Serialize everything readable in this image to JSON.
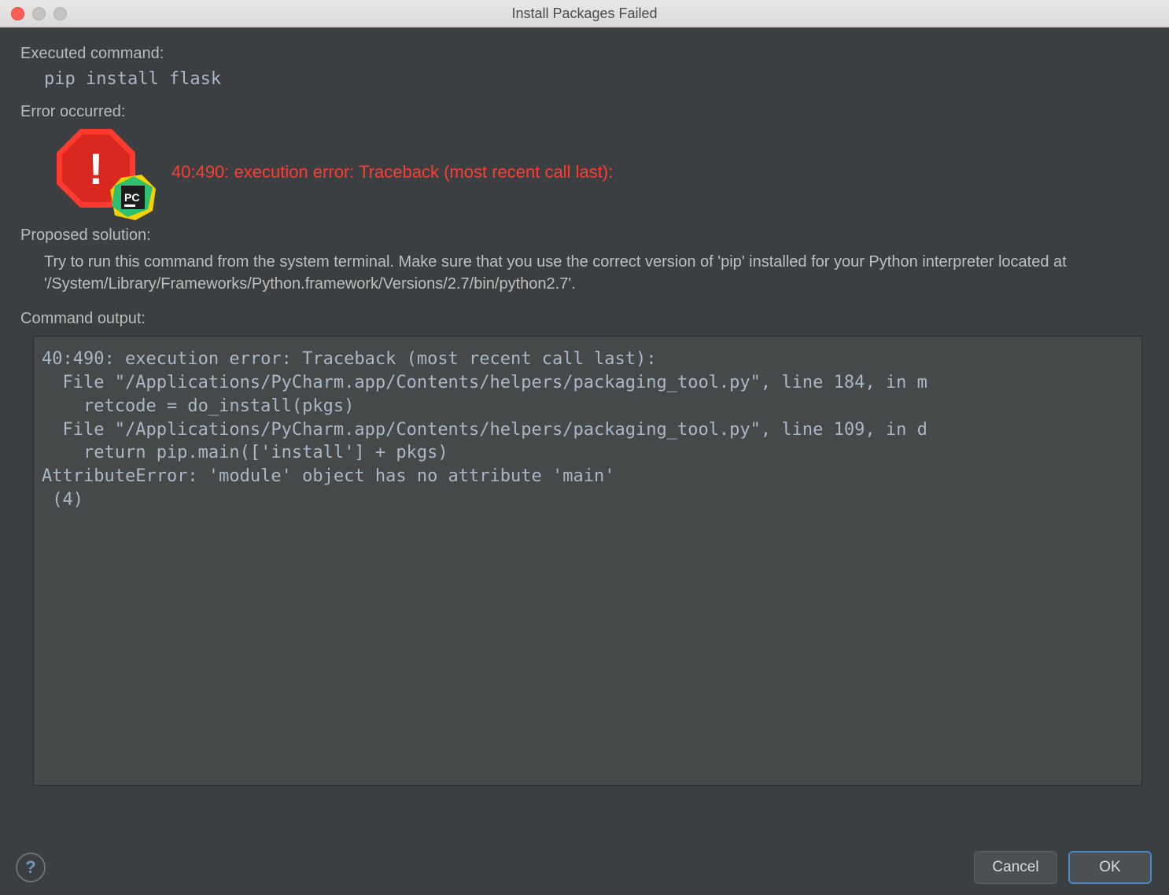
{
  "window": {
    "title": "Install Packages Failed"
  },
  "labels": {
    "executed_command": "Executed command:",
    "error_occurred": "Error occurred:",
    "proposed_solution": "Proposed solution:",
    "command_output": "Command output:"
  },
  "executed_command_value": "pip install flask",
  "error_message": "40:490: execution error: Traceback (most recent call last):",
  "icons": {
    "stop": "stop-icon",
    "app_badge": "PC"
  },
  "proposed_solution_text": "Try to run this command from the system terminal. Make sure that you use the correct version of 'pip' installed for your Python interpreter located at '/System/Library/Frameworks/Python.framework/Versions/2.7/bin/python2.7'.",
  "command_output_text": "40:490: execution error: Traceback (most recent call last):\n  File \"/Applications/PyCharm.app/Contents/helpers/packaging_tool.py\", line 184, in m\n    retcode = do_install(pkgs)\n  File \"/Applications/PyCharm.app/Contents/helpers/packaging_tool.py\", line 109, in d\n    return pip.main(['install'] + pkgs)\nAttributeError: 'module' object has no attribute 'main'\n (4)",
  "buttons": {
    "help": "?",
    "cancel": "Cancel",
    "ok": "OK"
  }
}
